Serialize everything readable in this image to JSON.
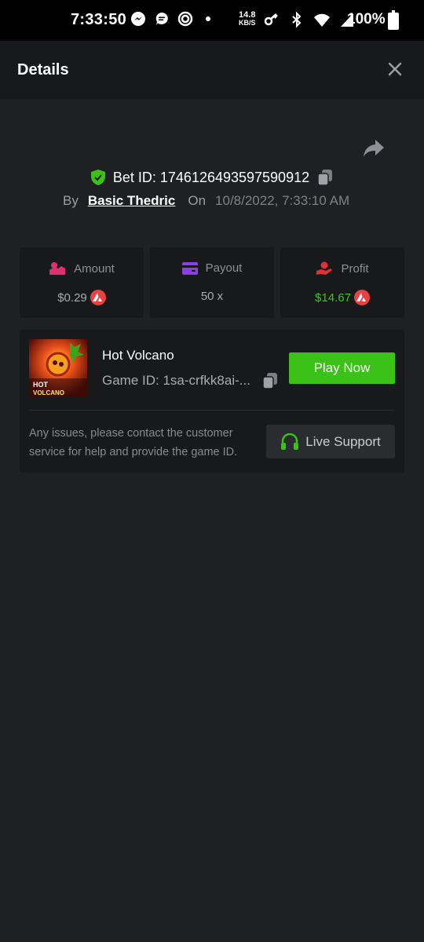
{
  "status_bar": {
    "time": "7:33:50",
    "speed_value": "14.8",
    "speed_unit": "KB/S",
    "battery": "100%"
  },
  "header": {
    "title": "Details"
  },
  "bet": {
    "label": "Bet ID: 1746126493597590912",
    "by_label": "By",
    "user": "Basic Thedric",
    "on_label": "On",
    "date": "10/8/2022, 7:33:10 AM"
  },
  "stats": {
    "amount": {
      "label": "Amount",
      "value": "$0.29"
    },
    "payout": {
      "label": "Payout",
      "value": "50 x"
    },
    "profit": {
      "label": "Profit",
      "value": "$14.67"
    }
  },
  "game": {
    "name": "Hot Volcano",
    "id_text": "Game ID: 1sa-crfkk8ai-...",
    "thumb_text_1": "HOT",
    "thumb_text_2": "VOLCANO",
    "play_label": "Play Now"
  },
  "support": {
    "text": "Any issues, please contact the customer service for help and provide the game ID.",
    "button_label": "Live Support"
  },
  "colors": {
    "accent_green": "#3bc117",
    "profit_green": "#35c91c",
    "coin_red": "#e84142",
    "background": "#1f2023",
    "card": "#18191b"
  }
}
